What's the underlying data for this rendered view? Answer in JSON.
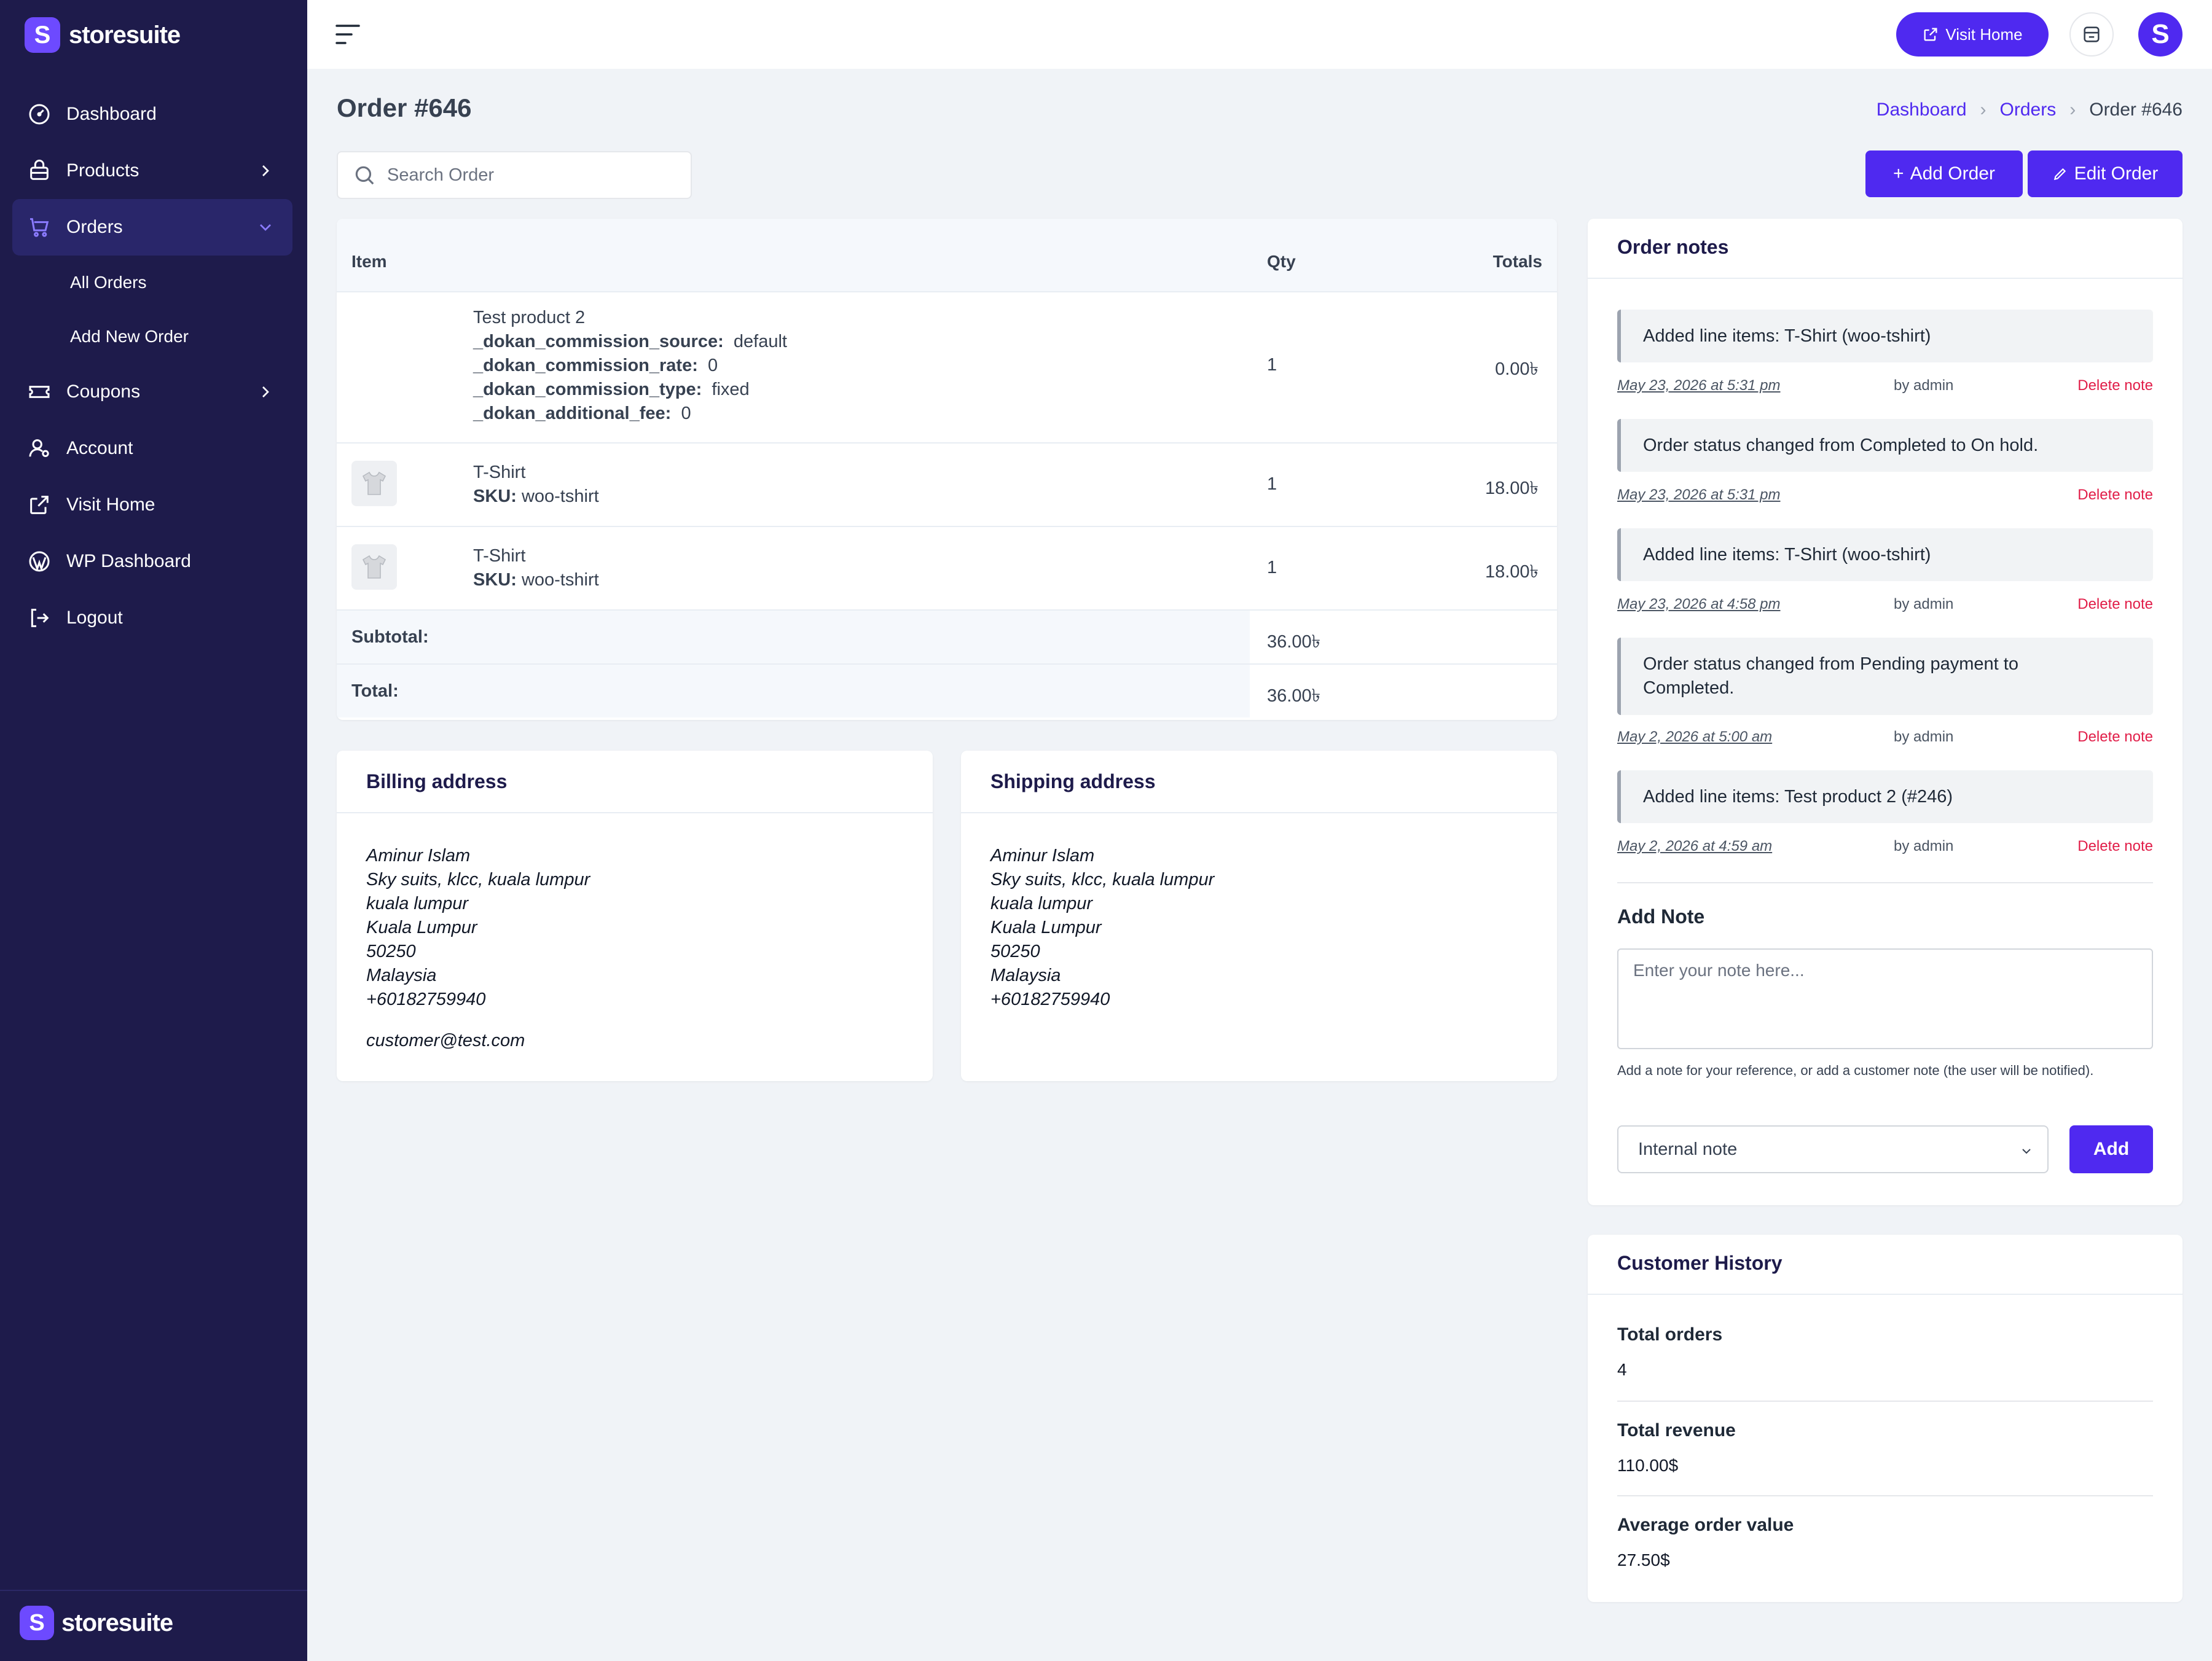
{
  "brand": {
    "name": "storesuite",
    "logo_letter": "S"
  },
  "sidebar": {
    "items": [
      {
        "label": "Dashboard",
        "icon": "dashboard-gauge-icon"
      },
      {
        "label": "Products",
        "icon": "products-icon"
      },
      {
        "label": "Orders",
        "icon": "orders-cart-icon"
      },
      {
        "label": "Coupons",
        "icon": "coupon-ticket-icon"
      },
      {
        "label": "Account",
        "icon": "account-user-icon"
      },
      {
        "label": "Visit Home",
        "icon": "external-link-icon"
      },
      {
        "label": "WP Dashboard",
        "icon": "wordpress-icon"
      },
      {
        "label": "Logout",
        "icon": "logout-icon"
      }
    ],
    "orders_sub": [
      "All Orders",
      "Add New Order"
    ]
  },
  "topbar": {
    "visit_home": "Visit Home",
    "avatar_letter": "S"
  },
  "page": {
    "title": "Order #646",
    "breadcrumb": [
      "Dashboard",
      "Orders",
      "Order #646"
    ],
    "search_placeholder": "Search Order",
    "add_order": "Add Order",
    "edit_order": "Edit Order"
  },
  "items_table": {
    "headers": {
      "item": "Item",
      "qty": "Qty",
      "totals": "Totals"
    },
    "rows": [
      {
        "name": "Test product 2",
        "meta": [
          {
            "key": "_dokan_commission_source:",
            "value": "default"
          },
          {
            "key": "_dokan_commission_rate:",
            "value": "0"
          },
          {
            "key": "_dokan_commission_type:",
            "value": "fixed"
          },
          {
            "key": "_dokan_additional_fee:",
            "value": "0"
          }
        ],
        "qty": "1",
        "total": "0.00৳"
      },
      {
        "name": "T-Shirt",
        "sku_label": "SKU:",
        "sku": "woo-tshirt",
        "qty": "1",
        "total": "18.00৳"
      },
      {
        "name": "T-Shirt",
        "sku_label": "SKU:",
        "sku": "woo-tshirt",
        "qty": "1",
        "total": "18.00৳"
      }
    ],
    "subtotal_label": "Subtotal:",
    "subtotal": "36.00৳",
    "total_label": "Total:",
    "total": "36.00৳"
  },
  "billing": {
    "title": "Billing address",
    "lines": [
      "Aminur Islam",
      "Sky suits, klcc, kuala lumpur",
      "kuala lumpur",
      "Kuala Lumpur",
      "50250",
      "Malaysia",
      "+60182759940"
    ],
    "email": "customer@test.com"
  },
  "shipping": {
    "title": "Shipping address",
    "lines": [
      "Aminur Islam",
      "Sky suits, klcc, kuala lumpur",
      "kuala lumpur",
      "Kuala Lumpur",
      "50250",
      "Malaysia",
      "+60182759940"
    ]
  },
  "notes": {
    "title": "Order notes",
    "items": [
      {
        "text": "Added line items: T-Shirt (woo-tshirt)",
        "date": "May 23, 2026 at 5:31 pm",
        "by": "by admin",
        "delete": "Delete note"
      },
      {
        "text": "Order status changed from Completed to On hold.",
        "date": "May 23, 2026 at 5:31 pm",
        "by": "",
        "delete": "Delete note"
      },
      {
        "text": "Added line items: T-Shirt (woo-tshirt)",
        "date": "May 23, 2026 at 4:58 pm",
        "by": "by admin",
        "delete": "Delete note"
      },
      {
        "text": "Order status changed from Pending payment to Completed.",
        "date": "May 2, 2026 at 5:00 am",
        "by": "by admin",
        "delete": "Delete note"
      },
      {
        "text": "Added line items: Test product 2 (#246)",
        "date": "May 2, 2026 at 4:59 am",
        "by": "by admin",
        "delete": "Delete note"
      }
    ],
    "add_title": "Add Note",
    "placeholder": "Enter your note here...",
    "help": "Add a note for your reference, or add a customer note (the user will be notified).",
    "type_selected": "Internal note",
    "add_button": "Add"
  },
  "history": {
    "title": "Customer History",
    "total_orders_label": "Total orders",
    "total_orders": "4",
    "total_revenue_label": "Total revenue",
    "total_revenue": "110.00$",
    "avg_label": "Average order value",
    "avg": "27.50$"
  },
  "colors": {
    "sidebar": "#1e1b4b",
    "accent": "#4f29f0",
    "danger": "#e11d48",
    "background": "#f0f3f7"
  }
}
